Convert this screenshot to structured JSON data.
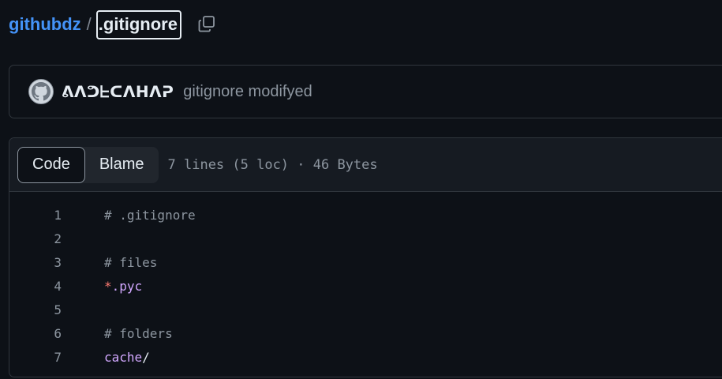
{
  "breadcrumb": {
    "repo": "githubdz",
    "separator": "/",
    "file": ".gitignore"
  },
  "commit": {
    "author": "ᕕᐱᕤᖶᑕᐱᕼᐱᕈ",
    "message": "gitignore modifyed"
  },
  "file_header": {
    "tabs": [
      {
        "label": "Code",
        "active": true
      },
      {
        "label": "Blame",
        "active": false
      }
    ],
    "meta": "7 lines (5 loc) · 46 Bytes"
  },
  "code": {
    "lines": [
      {
        "num": "1",
        "parts": [
          {
            "text": "# .gitignore",
            "kind": "comment"
          }
        ]
      },
      {
        "num": "2",
        "parts": []
      },
      {
        "num": "3",
        "parts": [
          {
            "text": "# files",
            "kind": "comment"
          }
        ]
      },
      {
        "num": "4",
        "parts": [
          {
            "text": "*",
            "kind": "op"
          },
          {
            "text": ".pyc",
            "kind": "key"
          }
        ]
      },
      {
        "num": "5",
        "parts": []
      },
      {
        "num": "6",
        "parts": [
          {
            "text": "# folders",
            "kind": "comment"
          }
        ]
      },
      {
        "num": "7",
        "parts": [
          {
            "text": "cache",
            "kind": "key"
          },
          {
            "text": "/",
            "kind": "plain"
          }
        ]
      }
    ]
  },
  "colors": {
    "background": "#0d1117",
    "link": "#4493f8",
    "comment": "#8d96a0",
    "operator": "#ff7b72",
    "keyword": "#d2a8ff"
  },
  "icons": {
    "copy": "copy-icon",
    "avatar": "github-octocat-icon"
  }
}
